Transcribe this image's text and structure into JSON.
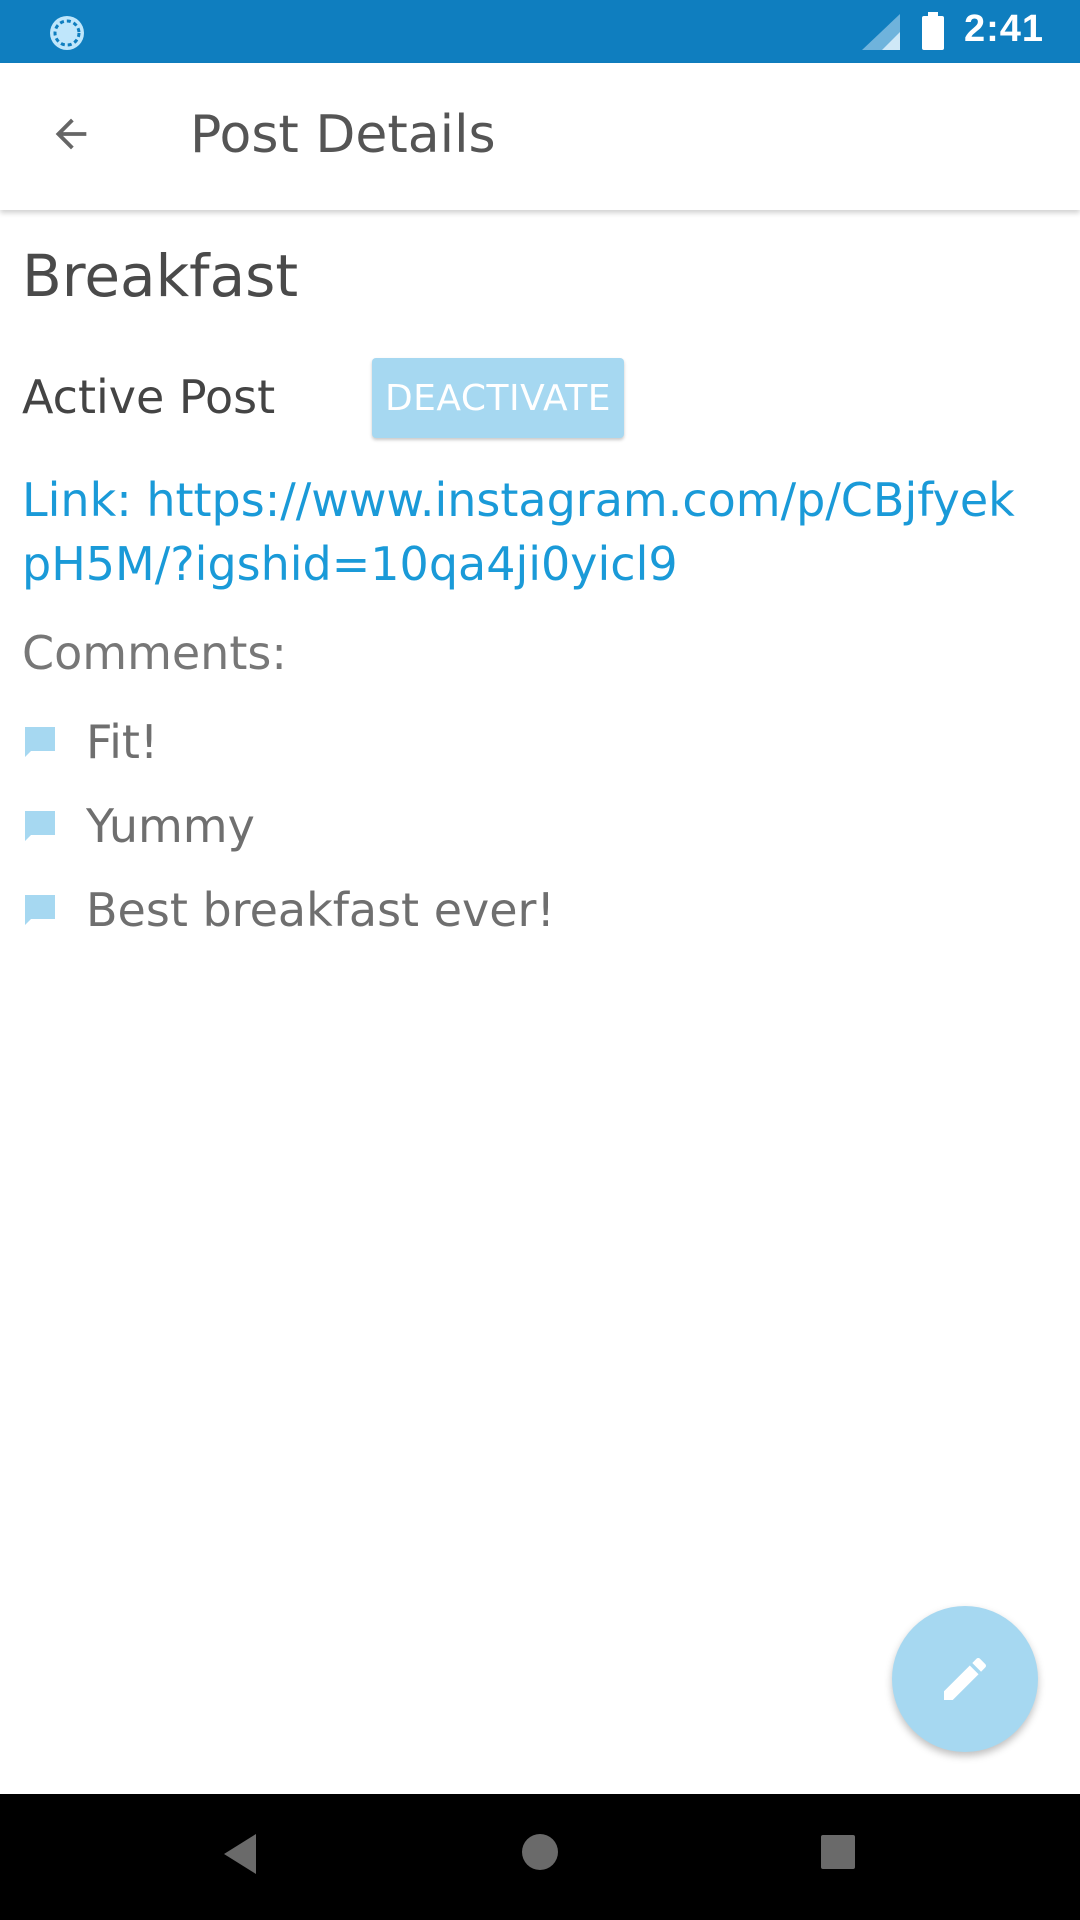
{
  "status_bar": {
    "time": "2:41",
    "left_icon": "sync-circle-icon",
    "signal_icon": "cell-signal-icon",
    "battery_icon": "battery-icon"
  },
  "app_bar": {
    "title": "Post Details",
    "back_icon": "arrow-back-icon"
  },
  "post": {
    "title": "Breakfast",
    "status_label": "Active Post",
    "deactivate_label": "DEACTIVATE",
    "link_text": "Link: https://www.instagram.com/p/CBjfyekpH5M/?igshid=10qa4ji0yicl9"
  },
  "comments": {
    "heading": "Comments:",
    "items": [
      {
        "text": "Fit!",
        "icon": "comment-bubble-icon"
      },
      {
        "text": "Yummy",
        "icon": "comment-bubble-icon"
      },
      {
        "text": "Best breakfast ever!",
        "icon": "comment-bubble-icon"
      }
    ]
  },
  "fab": {
    "icon": "edit-pencil-icon"
  },
  "nav_bar": {
    "back_icon": "nav-back-triangle-icon",
    "home_icon": "nav-home-circle-icon",
    "recents_icon": "nav-recents-square-icon"
  },
  "colors": {
    "status_bar": "#0f7ebf",
    "accent_light": "#a6d8f1",
    "link": "#1a9ad8"
  }
}
